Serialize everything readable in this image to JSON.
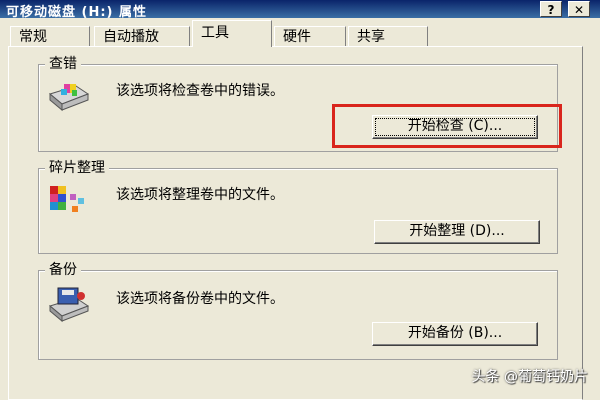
{
  "window": {
    "title": "可移动磁盘 (H:) 属性",
    "help_label": "?",
    "close_label": "✕"
  },
  "tabs": [
    {
      "label": "常规",
      "active": false
    },
    {
      "label": "自动播放",
      "active": false
    },
    {
      "label": "工具",
      "active": true
    },
    {
      "label": "硬件",
      "active": false
    },
    {
      "label": "共享",
      "active": false
    }
  ],
  "groups": {
    "check": {
      "legend": "查错",
      "desc": "该选项将检查卷中的错误。",
      "button": "开始检查 (C)...",
      "icon": "check-disk-icon"
    },
    "defrag": {
      "legend": "碎片整理",
      "desc": "该选项将整理卷中的文件。",
      "button": "开始整理 (D)...",
      "icon": "defragment-icon"
    },
    "backup": {
      "legend": "备份",
      "desc": "该选项将备份卷中的文件。",
      "button": "开始备份 (B)...",
      "icon": "backup-icon"
    }
  },
  "watermark": "头条 @葡萄钙奶片",
  "colors": {
    "highlight": "#d9251c",
    "dialog_bg": "#ece9d8"
  }
}
